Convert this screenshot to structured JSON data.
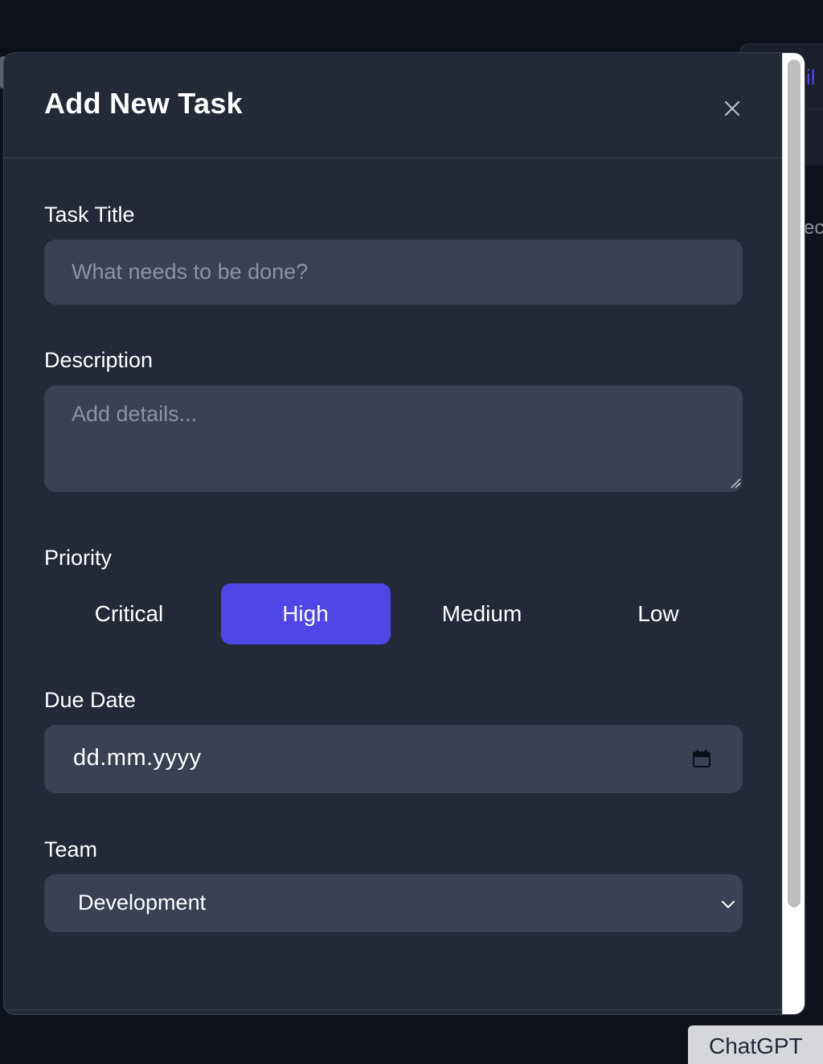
{
  "modal": {
    "title": "Add New Task",
    "close_icon": "close-icon"
  },
  "form": {
    "task_title": {
      "label": "Task Title",
      "placeholder": "What needs to be done?",
      "value": ""
    },
    "description": {
      "label": "Description",
      "placeholder": "Add details...",
      "value": ""
    },
    "priority": {
      "label": "Priority",
      "options": [
        "Critical",
        "High",
        "Medium",
        "Low"
      ],
      "selected": "High"
    },
    "due_date": {
      "label": "Due Date",
      "value": "dd.mm.yyyy",
      "icon": "calendar-icon"
    },
    "team": {
      "label": "Team",
      "selected": "Development",
      "icon": "chevron-down-icon"
    }
  },
  "colors": {
    "modal_bg": "#232937",
    "input_bg": "#394152",
    "accent": "#4f46e5",
    "page_bg": "#0f131c"
  },
  "overlay": {
    "chatgpt_tab": "ChatGPT"
  }
}
